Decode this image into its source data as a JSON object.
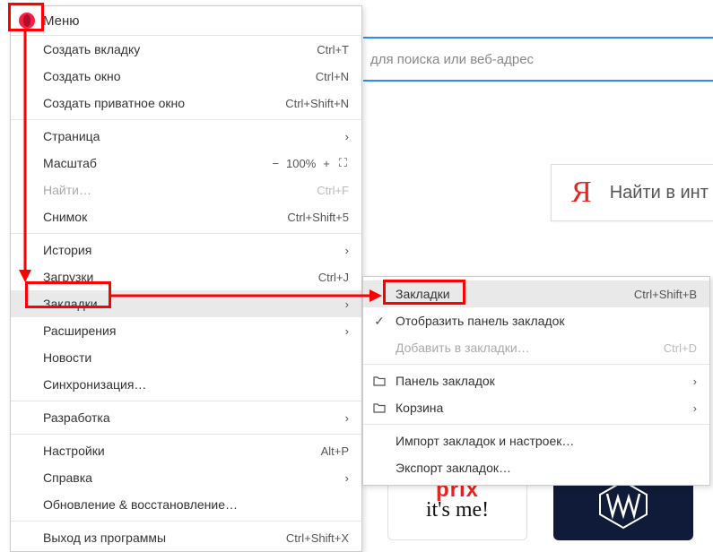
{
  "header": {
    "title": "Меню"
  },
  "addressbar": {
    "placeholder": "для поиска или веб-адрес"
  },
  "yandex": {
    "letter": "Я",
    "label": "Найти в инт"
  },
  "tiles": {
    "prix": {
      "line1": "prix",
      "line2": "it's me!"
    }
  },
  "menu": {
    "new_tab": {
      "label": "Создать вкладку",
      "shortcut": "Ctrl+T"
    },
    "new_window": {
      "label": "Создать окно",
      "shortcut": "Ctrl+N"
    },
    "new_private": {
      "label": "Создать приватное окно",
      "shortcut": "Ctrl+Shift+N"
    },
    "page": {
      "label": "Страница"
    },
    "zoom": {
      "label": "Масштаб",
      "minus": "−",
      "level": "100%",
      "plus": "+",
      "full": "⛶"
    },
    "find": {
      "label": "Найти…",
      "shortcut": "Ctrl+F"
    },
    "snapshot": {
      "label": "Снимок",
      "shortcut": "Ctrl+Shift+5"
    },
    "history": {
      "label": "История"
    },
    "downloads": {
      "label": "Загрузки",
      "shortcut": "Ctrl+J"
    },
    "bookmarks": {
      "label": "Закладки"
    },
    "extensions": {
      "label": "Расширения"
    },
    "news": {
      "label": "Новости"
    },
    "sync": {
      "label": "Синхронизация…"
    },
    "developer": {
      "label": "Разработка"
    },
    "settings": {
      "label": "Настройки",
      "shortcut": "Alt+P"
    },
    "help": {
      "label": "Справка"
    },
    "update": {
      "label": "Обновление & восстановление…"
    },
    "exit": {
      "label": "Выход из программы",
      "shortcut": "Ctrl+Shift+X"
    }
  },
  "submenu": {
    "bookmarks": {
      "label": "Закладки",
      "shortcut": "Ctrl+Shift+B"
    },
    "show_bar": {
      "label": "Отобразить панель закладок"
    },
    "add": {
      "label": "Добавить в закладки…",
      "shortcut": "Ctrl+D"
    },
    "bar": {
      "label": "Панель закладок"
    },
    "trash": {
      "label": "Корзина"
    },
    "import": {
      "label": "Импорт закладок и настроек…"
    },
    "export": {
      "label": "Экспорт закладок…"
    }
  }
}
